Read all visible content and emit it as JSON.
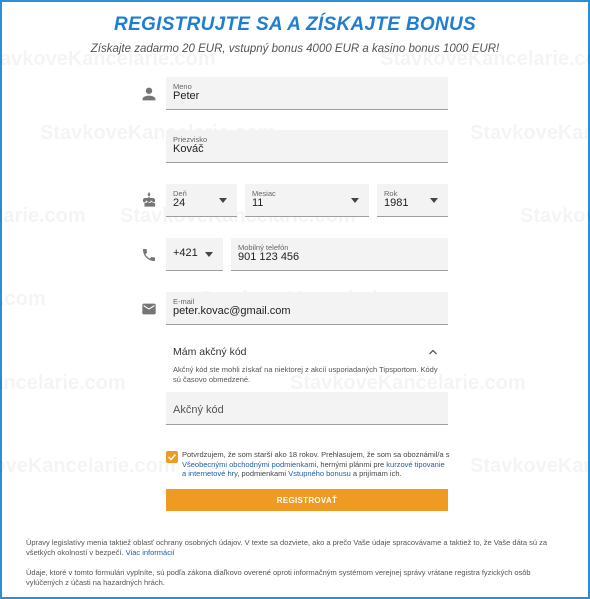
{
  "title": "REGISTRUJTE SA A ZÍSKAJTE BONUS",
  "subtitle": "Získajte zadarmo 20 EUR, vstupný bonus 4000 EUR a kasino bonus 1000 EUR!",
  "watermark_text": "StavkoveKancelarie.com",
  "form": {
    "name": {
      "label": "Meno",
      "value": "Peter"
    },
    "surname": {
      "label": "Priezvisko",
      "value": "Kováč"
    },
    "day": {
      "label": "Deň",
      "value": "24"
    },
    "month": {
      "label": "Mesiac",
      "value": "11"
    },
    "year": {
      "label": "Rok",
      "value": "1981"
    },
    "prefix": {
      "value": "+421"
    },
    "phone": {
      "label": "Mobilný telefón",
      "value": "901 123 456"
    },
    "email": {
      "label": "E-mail",
      "value": "peter.kovac@gmail.com"
    }
  },
  "promo": {
    "title": "Mám akčný kód",
    "description": "Akčný kód ste mohli získať na niektorej z akcií usporiadaných Tipsportom. Kódy sú časovo obmedzené.",
    "placeholder": "Akčný kód"
  },
  "consent": {
    "text_1": "Potvrdzujem, že som starší ako 18 rokov. Prehlasujem, že som sa oboznámil/a s",
    "link_terms": "Všeobecnými obchodnými podmienkami",
    "text_2": ", hernými plánmi pre",
    "link_betting": "kurzové tipovanie a internetové hry",
    "text_3": ", podmienkami",
    "link_bonus": "Vstupného bonusu",
    "text_4": "a prijímam ich."
  },
  "submit_label": "REGISTROVAŤ",
  "legal": {
    "p1_text": "Úpravy legislatívy menia taktiež oblasť ochrany osobných údajov. V texte sa dozviete, ako a prečo Vaše údaje spracovávame a taktiež to, že Vaše dáta sú za všetkých okolností v bezpečí.",
    "p1_link": "Viac informácií",
    "p2_text": "Údaje, ktoré v tomto formulári vyplníte, sú podľa zákona diaľkovo overené oproti informačným systémom verejnej správy vrátane registra fyzických osôb vylúčených z účasti na hazardných hrách."
  },
  "icons": {
    "name": "person-icon",
    "birthdate": "cake-icon",
    "phone": "phone-icon",
    "email": "mail-icon",
    "promo": "chevron-up-icon",
    "check": "check-icon"
  },
  "colors": {
    "title": "#1f7ed1",
    "accent": "#ef9a22",
    "link": "#1f5fa8",
    "frame": "#2b8fd6"
  }
}
